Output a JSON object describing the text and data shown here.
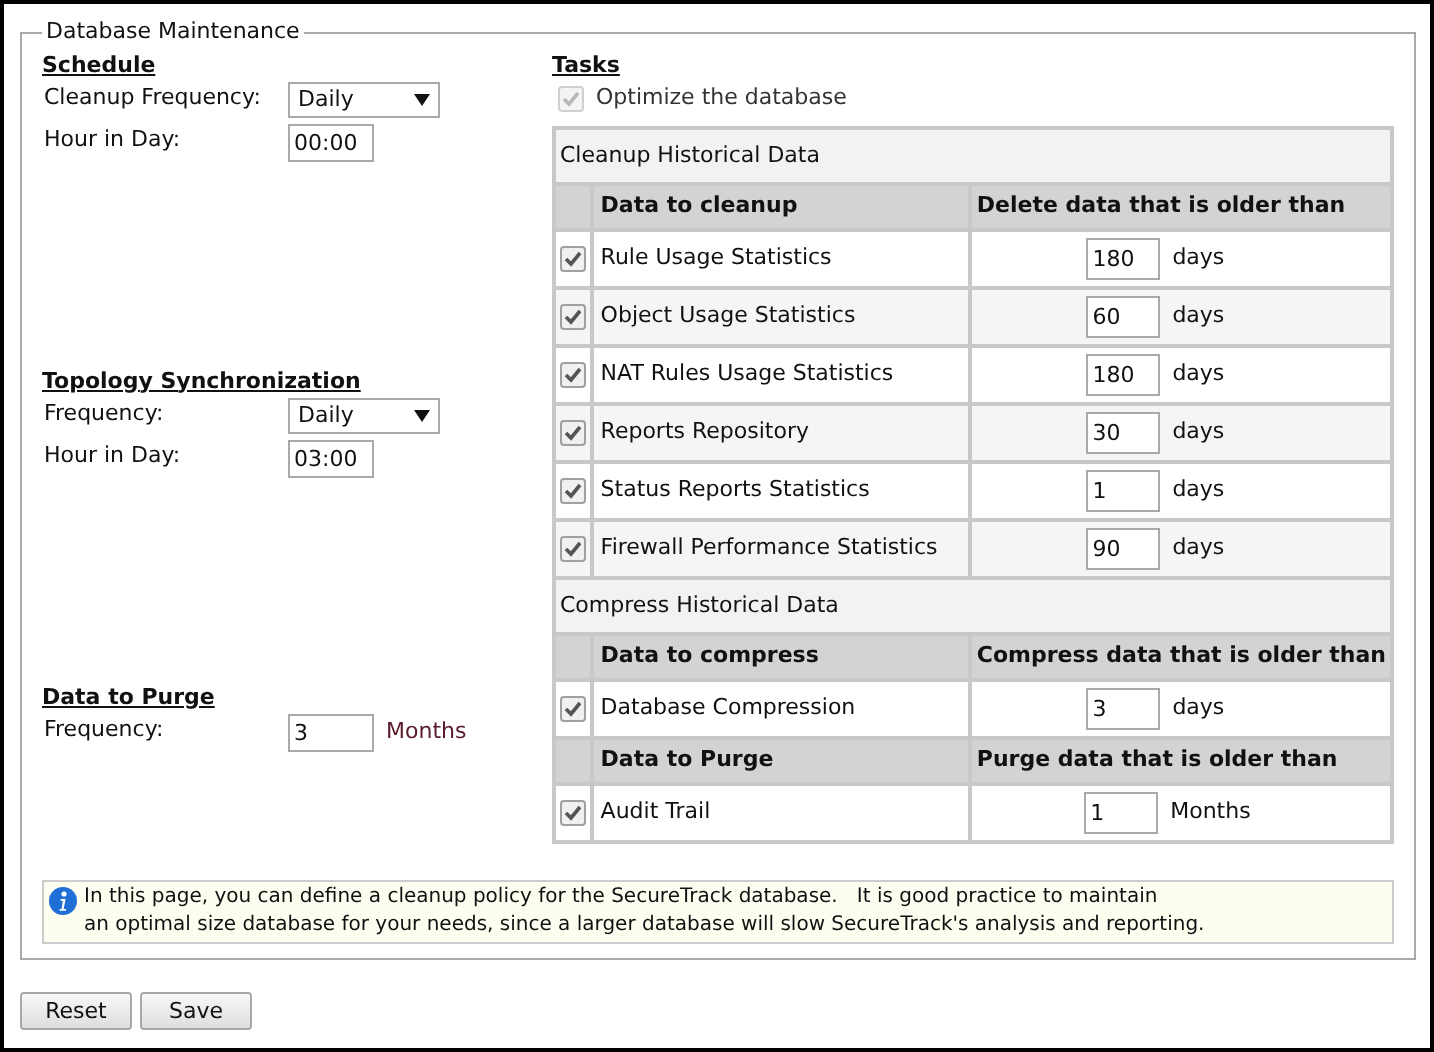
{
  "fieldset_title": "Database Maintenance",
  "left_sections": [
    {
      "title": "Schedule",
      "fields": [
        {
          "kind": "select",
          "label": "Cleanup Frequency:",
          "value": "Daily"
        },
        {
          "kind": "text",
          "label": "Hour in Day:",
          "value": "00:00"
        }
      ]
    },
    {
      "title": "Topology Synchronization",
      "fields": [
        {
          "kind": "select",
          "label": "Frequency:",
          "value": "Daily"
        },
        {
          "kind": "text",
          "label": "Hour in Day:",
          "value": "03:00"
        }
      ]
    },
    {
      "title": "Data to Purge",
      "fields": [
        {
          "kind": "text",
          "label": "Frequency:",
          "value": "3",
          "unit": "Months"
        }
      ]
    }
  ],
  "tasks": {
    "title": "Tasks",
    "optimize": {
      "label": "Optimize the database",
      "checked": true,
      "disabled": true
    },
    "groups": [
      {
        "title": "Cleanup Historical Data",
        "header": [
          "Data to cleanup",
          "Delete data that is older than"
        ],
        "rows": [
          {
            "name": "Rule Usage Statistics",
            "checked": true,
            "value": "180",
            "unit": "days"
          },
          {
            "name": "Object Usage Statistics",
            "checked": true,
            "value": "60",
            "unit": "days"
          },
          {
            "name": "NAT Rules Usage Statistics",
            "checked": true,
            "value": "180",
            "unit": "days"
          },
          {
            "name": "Reports Repository",
            "checked": true,
            "value": "30",
            "unit": "days"
          },
          {
            "name": "Status Reports Statistics",
            "checked": true,
            "value": "1",
            "unit": "days"
          },
          {
            "name": "Firewall Performance Statistics",
            "checked": true,
            "value": "90",
            "unit": "days"
          }
        ]
      },
      {
        "title": "Compress Historical Data",
        "header": [
          "Data to compress",
          "Compress data that is older than"
        ],
        "rows": [
          {
            "name": "Database Compression",
            "checked": true,
            "value": "3",
            "unit": "days"
          }
        ]
      },
      {
        "header": [
          "Data to Purge",
          "Purge data that is older than"
        ],
        "rows": [
          {
            "name": "Audit Trail",
            "checked": true,
            "value": "1",
            "unit": "Months"
          }
        ]
      }
    ]
  },
  "info_lines": [
    "In this page, you can define a cleanup policy for the SecureTrack database.   It is good practice to maintain",
    "an optimal size database for your needs, since a larger database will slow SecureTrack's analysis and reporting."
  ],
  "buttons": [
    "Reset",
    "Save"
  ]
}
